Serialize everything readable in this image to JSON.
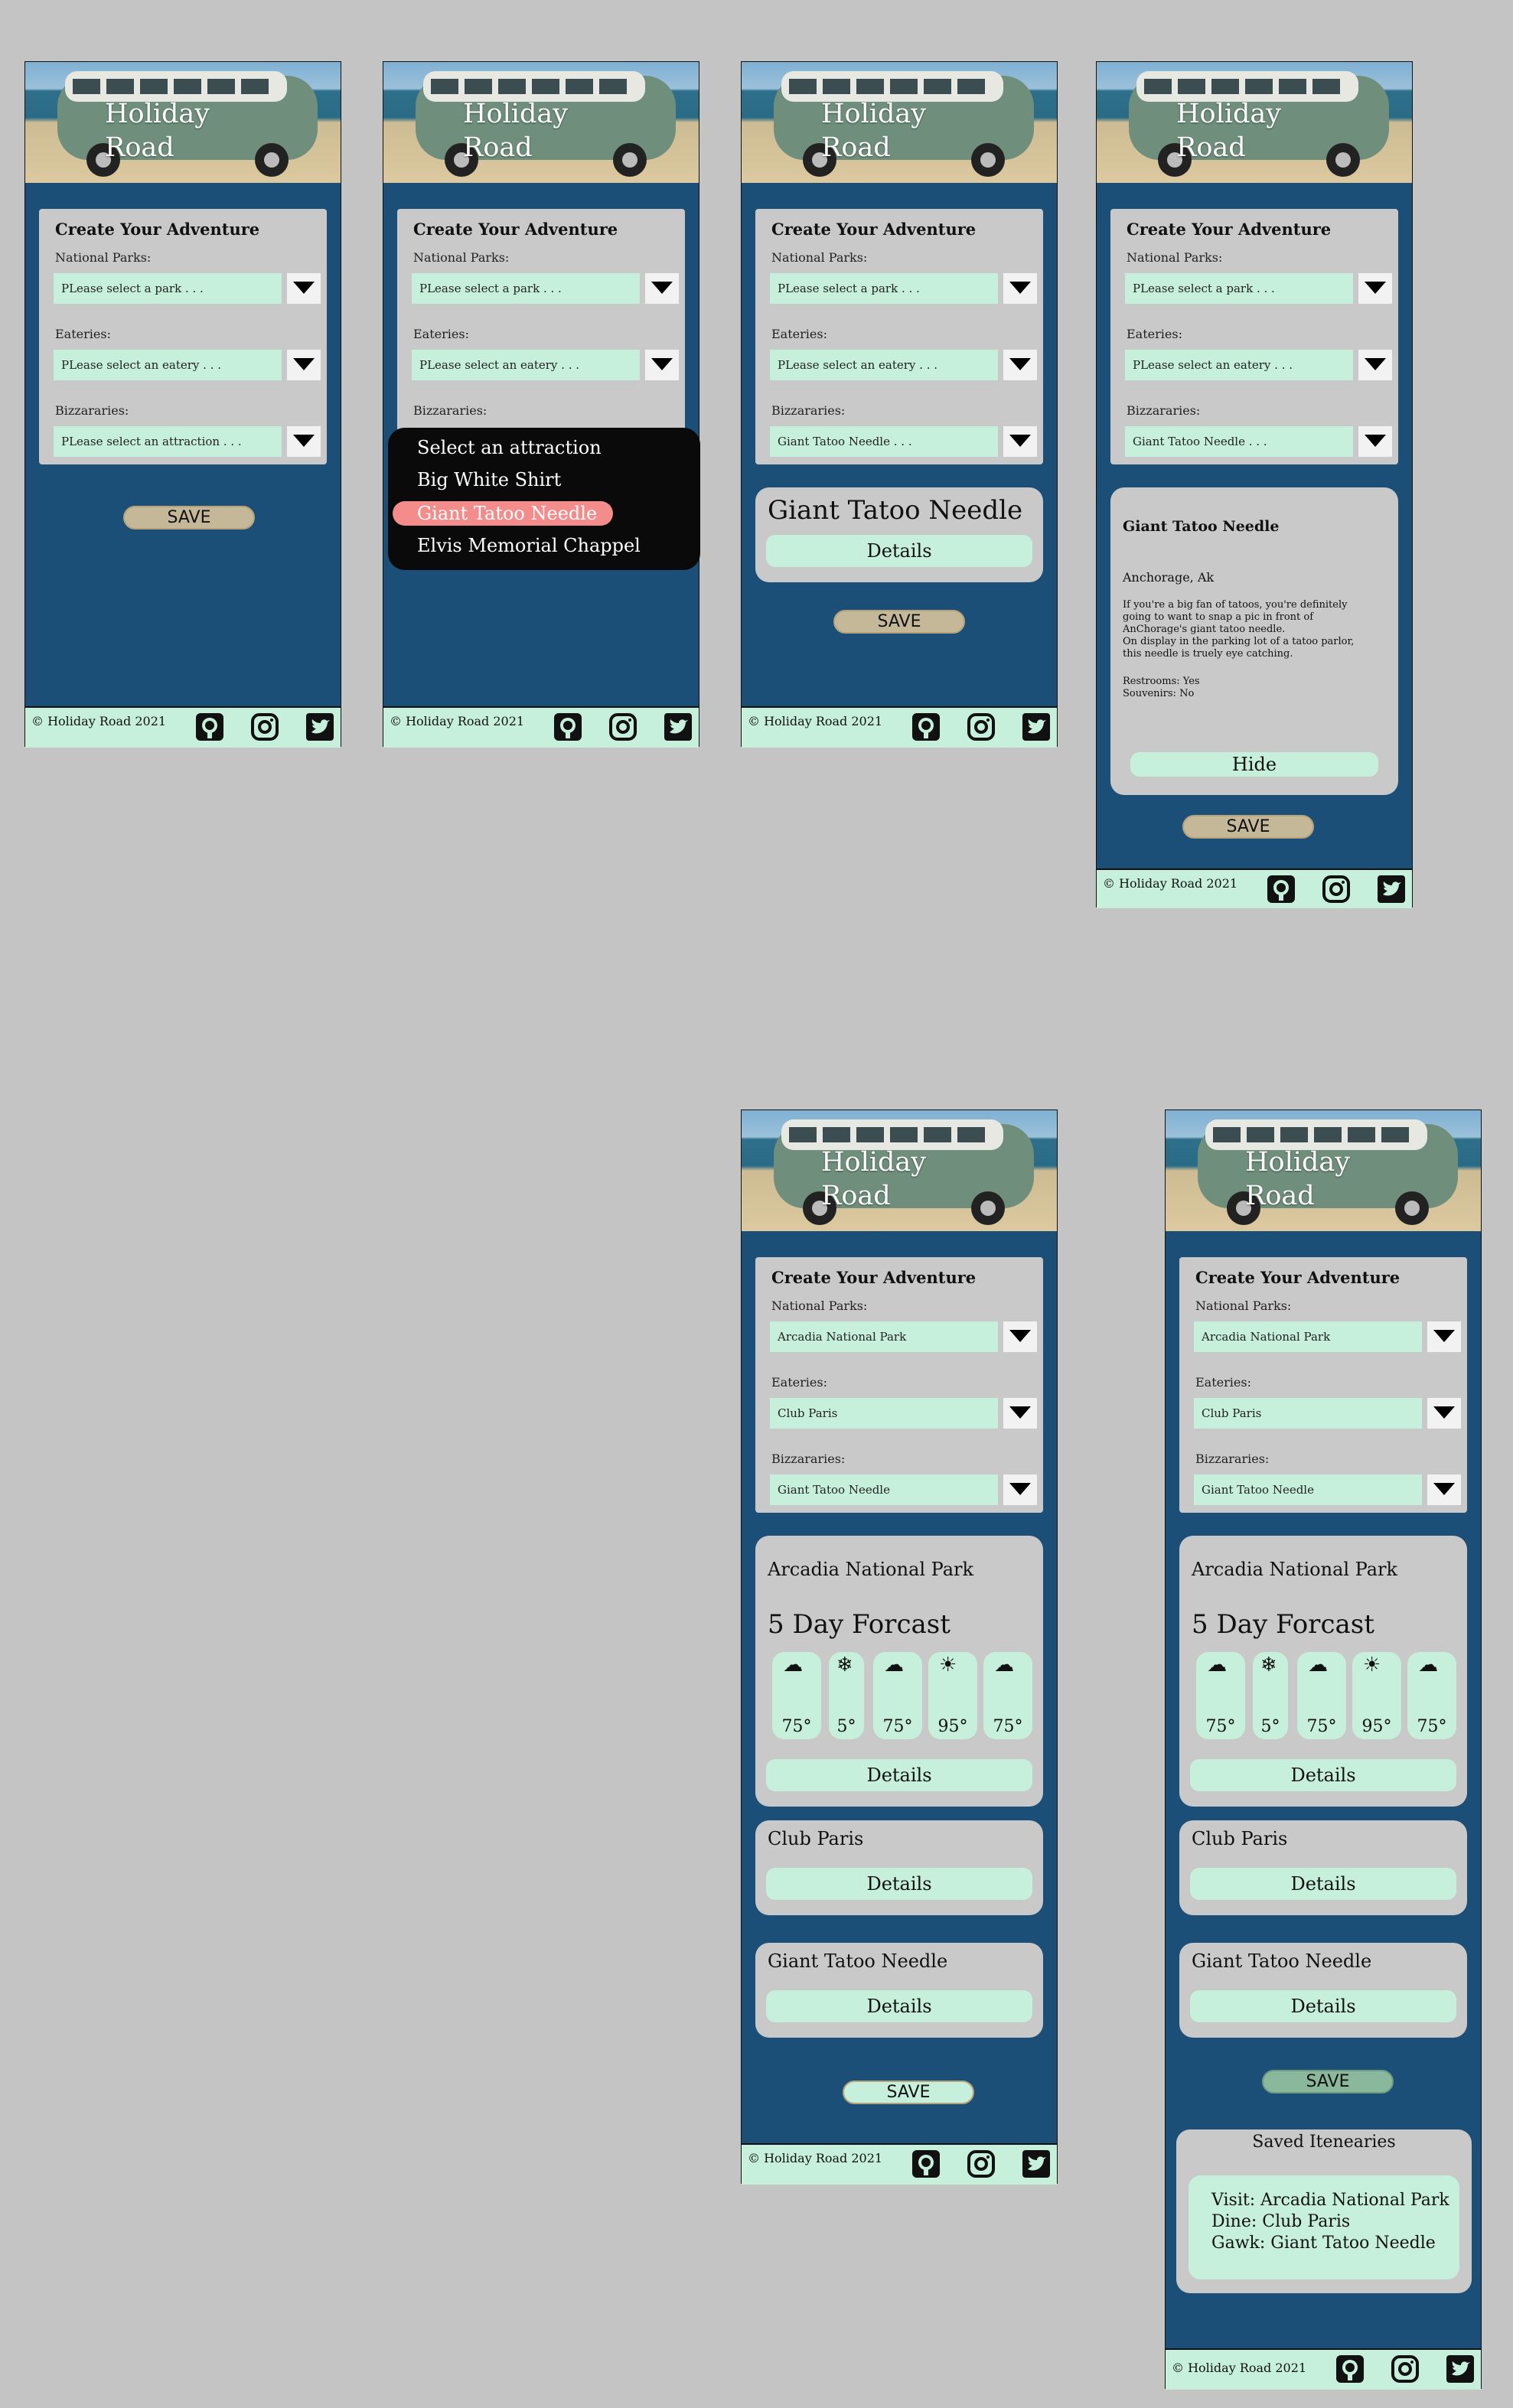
{
  "app": {
    "title_line1": "Holiday",
    "title_line2": "Road",
    "footer_text": "© Holiday Road 2021",
    "save_label": "SAVE"
  },
  "form": {
    "title": "Create Your Adventure",
    "parks_label": "National Parks:",
    "eateries_label": "Eateries:",
    "bizzararies_label": "Bizzararies:",
    "park_placeholder": "PLease select  a park . . .",
    "eatery_placeholder": "PLease select  an eatery . . .",
    "attraction_placeholder": "PLease select  an attraction . . .",
    "attraction_selected_ellipsis": "Giant Tatoo Needle . . .",
    "park_selected": "Arcadia National Park",
    "eatery_selected": "Club Paris",
    "attraction_selected": "Giant Tatoo Needle"
  },
  "dropdown": {
    "items": [
      "Select an attraction",
      "Big White Shirt",
      "Giant Tatoo Needle",
      "Elvis Memorial Chappel"
    ],
    "highlighted_index": 2
  },
  "attraction_card": {
    "name": "Giant Tatoo Needle",
    "details_label": "Details",
    "hide_label": "Hide",
    "location": "Anchorage, Ak",
    "description": [
      "If you're a big fan of tatoos, you're definitely",
      "going to want to snap a pic in front of",
      "AnChorage's giant tatoo needle.",
      "On display in the parking lot of a tatoo parlor,",
      "this needle is truely eye catching."
    ],
    "restrooms": "Restrooms: Yes",
    "souvenirs": "Souvenirs: No"
  },
  "park_card": {
    "name": "Arcadia National Park",
    "forecast_title": "5 Day Forcast",
    "forecast": [
      {
        "icon": "rain-cloud-icon",
        "glyph": "☁",
        "temp": "75°"
      },
      {
        "icon": "snowflake-icon",
        "glyph": "❄",
        "temp": "5°"
      },
      {
        "icon": "rain-cloud-icon",
        "glyph": "☁",
        "temp": "75°"
      },
      {
        "icon": "sun-icon",
        "glyph": "☀",
        "temp": "95°"
      },
      {
        "icon": "rain-cloud-icon",
        "glyph": "☁",
        "temp": "75°"
      }
    ],
    "details_label": "Details"
  },
  "eatery_card": {
    "name": "Club Paris",
    "details_label": "Details"
  },
  "saved": {
    "title": "Saved Itenearies",
    "line1": "Visit: Arcadia National Park",
    "line2": "Dine: Club Paris",
    "line3": "Gawk: Giant Tatoo Needle"
  },
  "icons": {
    "footer": [
      "github-icon",
      "instagram-icon",
      "twitter-icon"
    ],
    "dropdown_arrow": "caret-down-icon"
  },
  "colors": {
    "background": "#c4c4c4",
    "screen_blue": "#1c4f78",
    "mint": "#c6f0dc",
    "card_gray": "#c9c9c9",
    "save_tan": "#c4b898",
    "highlight_pink": "#f48c8c"
  }
}
